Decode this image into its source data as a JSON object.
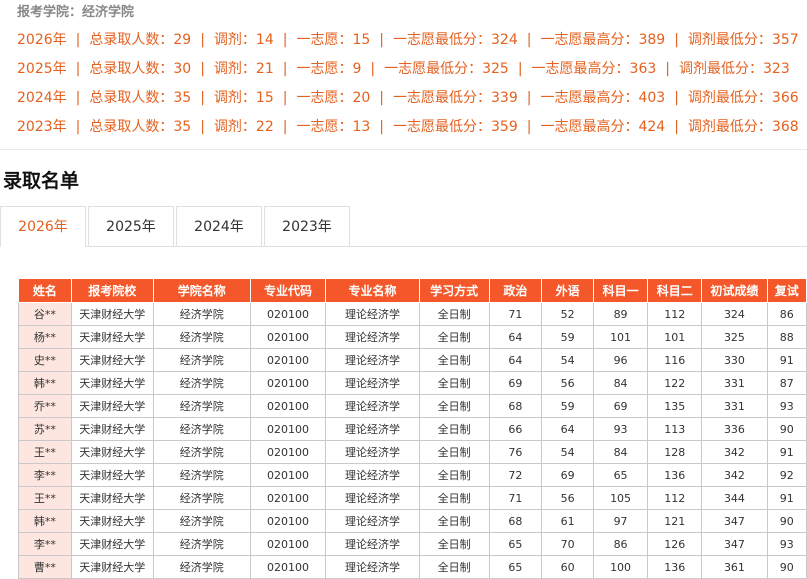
{
  "header": {
    "school_label": "报考学院：经济学院"
  },
  "stats": [
    {
      "year": "2026年",
      "total": "总录取人数：29",
      "adjust": "调剂：14",
      "first": "一志愿：15",
      "first_min": "一志愿最低分：324",
      "first_max": "一志愿最高分：389",
      "adjust_min": "调剂最低分：357"
    },
    {
      "year": "2025年",
      "total": "总录取人数：30",
      "adjust": "调剂：21",
      "first": "一志愿：9",
      "first_min": "一志愿最低分：325",
      "first_max": "一志愿最高分：363",
      "adjust_min": "调剂最低分：323"
    },
    {
      "year": "2024年",
      "total": "总录取人数：35",
      "adjust": "调剂：15",
      "first": "一志愿：20",
      "first_min": "一志愿最低分：339",
      "first_max": "一志愿最高分：403",
      "adjust_min": "调剂最低分：366"
    },
    {
      "year": "2023年",
      "total": "总录取人数：35",
      "adjust": "调剂：22",
      "first": "一志愿：13",
      "first_min": "一志愿最低分：359",
      "first_max": "一志愿最高分：424",
      "adjust_min": "调剂最低分：368"
    }
  ],
  "section_title": "录取名单",
  "tabs": [
    "2026年",
    "2025年",
    "2024年",
    "2023年"
  ],
  "active_tab": "2026年",
  "table": {
    "headers": [
      "姓名",
      "报考院校",
      "学院名称",
      "专业代码",
      "专业名称",
      "学习方式",
      "政治",
      "外语",
      "科目一",
      "科目二",
      "初试成绩",
      "复试"
    ],
    "rows": [
      [
        "谷**",
        "天津财经大学",
        "经济学院",
        "020100",
        "理论经济学",
        "全日制",
        "71",
        "52",
        "89",
        "112",
        "324",
        "86"
      ],
      [
        "杨**",
        "天津财经大学",
        "经济学院",
        "020100",
        "理论经济学",
        "全日制",
        "64",
        "59",
        "101",
        "101",
        "325",
        "88"
      ],
      [
        "史**",
        "天津财经大学",
        "经济学院",
        "020100",
        "理论经济学",
        "全日制",
        "64",
        "54",
        "96",
        "116",
        "330",
        "91"
      ],
      [
        "韩**",
        "天津财经大学",
        "经济学院",
        "020100",
        "理论经济学",
        "全日制",
        "69",
        "56",
        "84",
        "122",
        "331",
        "87"
      ],
      [
        "乔**",
        "天津财经大学",
        "经济学院",
        "020100",
        "理论经济学",
        "全日制",
        "68",
        "59",
        "69",
        "135",
        "331",
        "93"
      ],
      [
        "苏**",
        "天津财经大学",
        "经济学院",
        "020100",
        "理论经济学",
        "全日制",
        "66",
        "64",
        "93",
        "113",
        "336",
        "90"
      ],
      [
        "王**",
        "天津财经大学",
        "经济学院",
        "020100",
        "理论经济学",
        "全日制",
        "76",
        "54",
        "84",
        "128",
        "342",
        "91"
      ],
      [
        "李**",
        "天津财经大学",
        "经济学院",
        "020100",
        "理论经济学",
        "全日制",
        "72",
        "69",
        "65",
        "136",
        "342",
        "92"
      ],
      [
        "王**",
        "天津财经大学",
        "经济学院",
        "020100",
        "理论经济学",
        "全日制",
        "71",
        "56",
        "105",
        "112",
        "344",
        "91"
      ],
      [
        "韩**",
        "天津财经大学",
        "经济学院",
        "020100",
        "理论经济学",
        "全日制",
        "68",
        "61",
        "97",
        "121",
        "347",
        "90"
      ],
      [
        "李**",
        "天津财经大学",
        "经济学院",
        "020100",
        "理论经济学",
        "全日制",
        "65",
        "70",
        "86",
        "126",
        "347",
        "93"
      ],
      [
        "曹**",
        "天津财经大学",
        "经济学院",
        "020100",
        "理论经济学",
        "全日制",
        "65",
        "60",
        "100",
        "136",
        "361",
        "90"
      ]
    ]
  }
}
